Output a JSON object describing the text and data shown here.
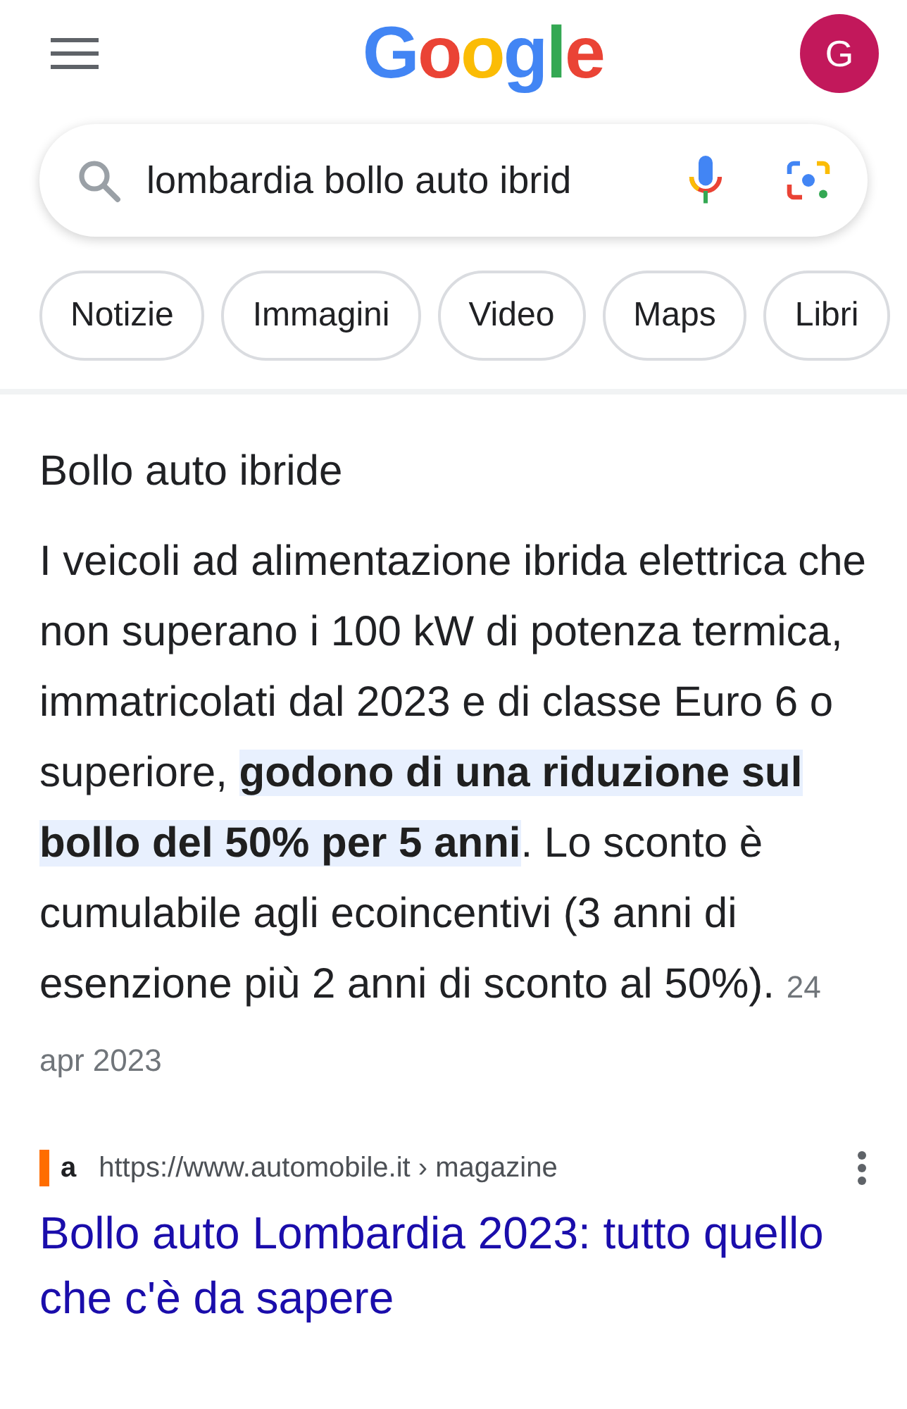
{
  "header": {
    "logo": "Google",
    "avatar": "G"
  },
  "search": {
    "value": "lombardia bollo auto ibrid"
  },
  "chips": [
    {
      "label": "Notizie"
    },
    {
      "label": "Immagini"
    },
    {
      "label": "Video"
    },
    {
      "label": "Maps"
    },
    {
      "label": "Libri"
    }
  ],
  "snippet": {
    "title": "Bollo auto ibride",
    "parts": [
      {
        "text": "I veicoli ad alimentazione ibrida elettrica che non superano i 100 kW di potenza termica, immatricolati dal 2023 e di classe Euro 6 o superiore, ",
        "highlighted": false
      },
      {
        "text": "godono di una riduzione sul bollo del 50% per 5 anni",
        "highlighted": true
      },
      {
        "text": ". Lo sconto è cumulabile agli ecoincentivi (3 anni di esenzione più 2 anni di sconto al 50%). ",
        "highlighted": false
      }
    ],
    "date": "24 apr 2023"
  },
  "result": {
    "favicon": "a",
    "url": "https://www.automobile.it › magazine",
    "title": "Bollo auto Lombardia 2023: tutto quello che c'è da sapere"
  }
}
